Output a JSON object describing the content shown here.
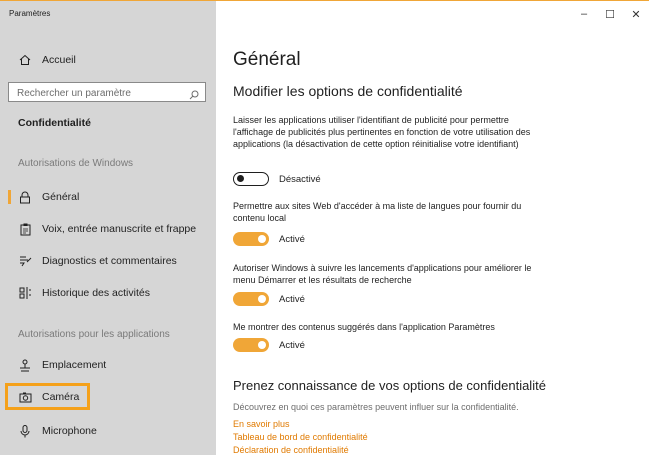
{
  "window": {
    "title": "Paramètres",
    "controls": {
      "minimize": "–",
      "maximize": "☐",
      "close": "✕"
    }
  },
  "sidebar": {
    "home": {
      "label": "Accueil",
      "icon": "home-icon"
    },
    "search": {
      "placeholder": "Rechercher un paramètre",
      "icon": "search-icon"
    },
    "section_title": "Confidentialité",
    "windows_group": {
      "header": "Autorisations de Windows",
      "items": [
        {
          "label": "Général",
          "icon": "lock-icon",
          "selected": true
        },
        {
          "label": "Voix, entrée manuscrite et frappe",
          "icon": "clipboard-icon"
        },
        {
          "label": "Diagnostics et commentaires",
          "icon": "feedback-icon"
        },
        {
          "label": "Historique des activités",
          "icon": "timeline-icon"
        }
      ]
    },
    "apps_group": {
      "header": "Autorisations pour les applications",
      "items": [
        {
          "label": "Emplacement",
          "icon": "location-icon"
        },
        {
          "label": "Caméra",
          "icon": "camera-icon",
          "highlighted": true
        },
        {
          "label": "Microphone",
          "icon": "microphone-icon"
        }
      ]
    },
    "accent_color": "#f0a637",
    "highlight_color": "#f5a11a"
  },
  "main": {
    "title": "Général",
    "subtitle": "Modifier les options de confidentialité",
    "settings": [
      {
        "description": "Laisser les applications utiliser l'identifiant de publicité pour permettre l'affichage de publicités plus pertinentes en fonction de votre utilisation des applications (la désactivation de cette option réinitialise votre identifiant)",
        "state": "Désactivé",
        "on": false
      },
      {
        "description": "Permettre aux sites Web d'accéder à ma liste de langues pour fournir du contenu local",
        "state": "Activé",
        "on": true
      },
      {
        "description": "Autoriser Windows à suivre les lancements d'applications pour améliorer le menu Démarrer et les résultats de recherche",
        "state": "Activé",
        "on": true
      },
      {
        "description": "Me montrer des contenus suggérés dans l'application Paramètres",
        "state": "Activé",
        "on": true
      }
    ],
    "learn": {
      "title": "Prenez connaissance de vos options de confidentialité",
      "description": "Découvrez en quoi ces paramètres peuvent influer sur la confidentialité.",
      "links": [
        "En savoir plus",
        "Tableau de bord de confidentialité",
        "Déclaration de confidentialité"
      ]
    },
    "link_color": "#e07a00"
  }
}
